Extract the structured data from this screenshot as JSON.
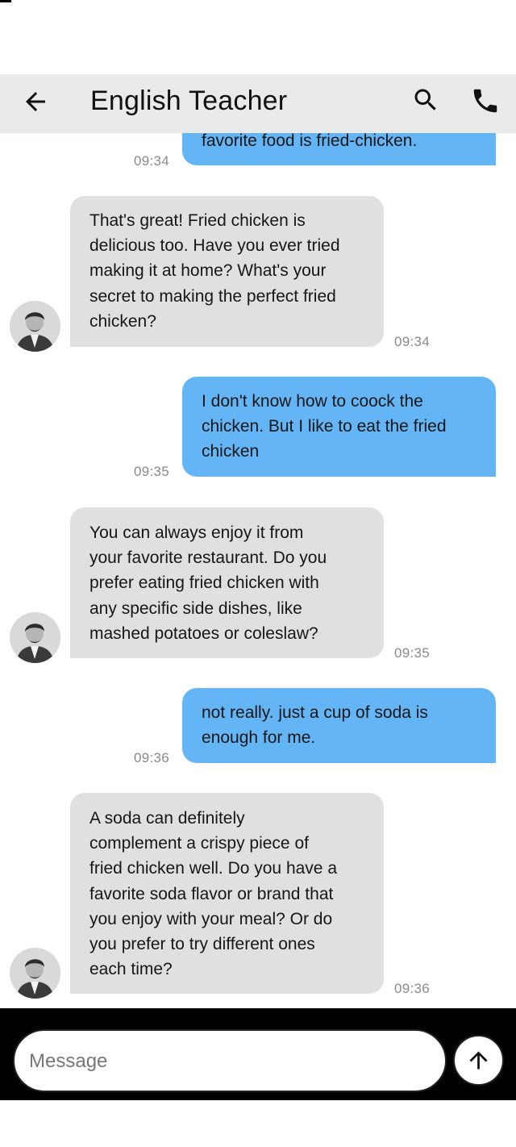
{
  "header": {
    "title": "English Teacher",
    "back_icon": "arrow-back-icon",
    "search_icon": "search-icon",
    "call_icon": "phone-icon"
  },
  "messages": [
    {
      "sender": "me",
      "text": "favorite food is fried-chicken.",
      "time": "09:34"
    },
    {
      "sender": "bot",
      "text": "That's great!  Fried chicken is\ndelicious too.  Have you ever tried\nmaking it at home?  What's your\nsecret to making the perfect fried\nchicken?",
      "time": "09:34"
    },
    {
      "sender": "me",
      "text": "I don't know how to coock the\nchicken. But I like to eat the fried\nchicken",
      "time": "09:35"
    },
    {
      "sender": "bot",
      "text": " You can always enjoy it from\nyour favorite restaurant.  Do you\nprefer eating fried chicken with\nany specific side dishes,  like\nmashed potatoes or coleslaw?",
      "time": "09:35"
    },
    {
      "sender": "me",
      "text": "not really. just a cup of soda is\nenough for me.",
      "time": "09:36"
    },
    {
      "sender": "bot",
      "text": "A soda can definitely\ncomplement a crispy piece of\nfried chicken well.  Do you have a\nfavorite soda flavor or brand that\nyou enjoy with your meal?  Or do\nyou prefer to try different ones\neach time?",
      "time": "09:36"
    }
  ],
  "composer": {
    "placeholder": "Message",
    "send_icon": "arrow-up-icon"
  },
  "colors": {
    "user_bubble": "#64b5f6",
    "bot_bubble": "#e0e0e0",
    "appbar": "#e9ebeb",
    "composer_bg": "#000000"
  }
}
